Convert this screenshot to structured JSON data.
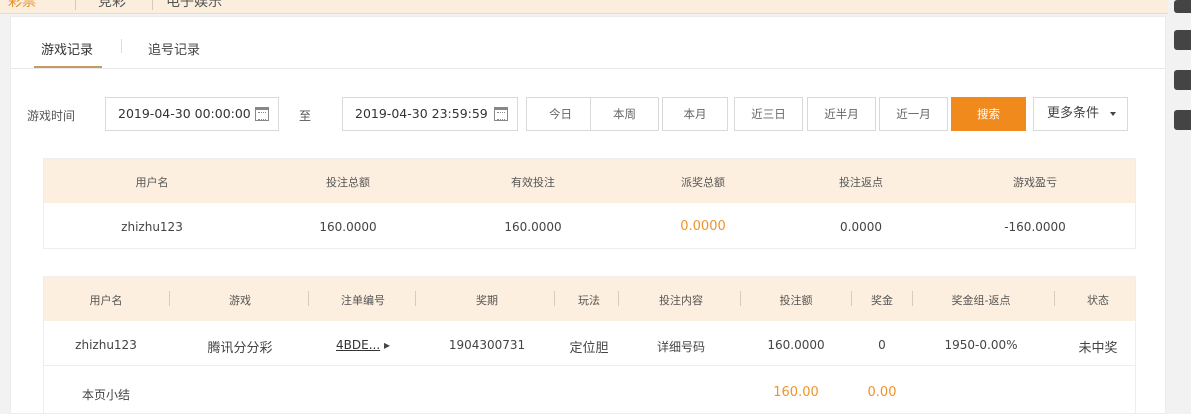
{
  "top_tabs": [
    "彩票",
    "竞彩",
    "电子娱乐"
  ],
  "sub_tabs": [
    "游戏记录",
    "追号记录"
  ],
  "filters": {
    "time_label": "游戏时间",
    "start": "2019-04-30 00:00:00",
    "to": "至",
    "end": "2019-04-30 23:59:59",
    "quick": [
      "今日",
      "本周",
      "本月",
      "近三日",
      "近半月",
      "近一月"
    ],
    "search": "搜索",
    "more": "更多条件"
  },
  "summary": {
    "headers": [
      "用户名",
      "投注总额",
      "有效投注",
      "派奖总额",
      "投注返点",
      "游戏盈亏"
    ],
    "row": [
      "zhizhu123",
      "160.0000",
      "160.0000",
      "0.0000",
      "0.0000",
      "-160.0000"
    ]
  },
  "detail": {
    "headers": [
      "用户名",
      "游戏",
      "注单编号",
      "奖期",
      "玩法",
      "投注内容",
      "投注额",
      "奖金",
      "奖金组-返点",
      "状态"
    ],
    "row": [
      "zhizhu123",
      "腾讯分分彩",
      "4BDE...",
      "1904300731",
      "定位胆",
      "详细号码",
      "160.0000",
      "0",
      "1950-0.00%",
      "未中奖"
    ],
    "subtotal_label": "本页小结",
    "subtotal_bet": "160.00",
    "subtotal_prize": "0.00"
  },
  "colors": {
    "accent": "#f08a1c",
    "header_bg": "#fcefdf"
  }
}
